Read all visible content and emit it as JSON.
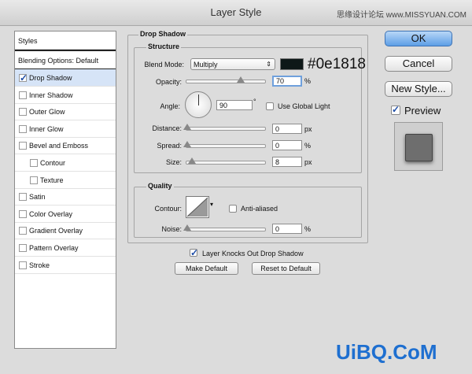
{
  "window": {
    "title": "Layer Style",
    "watermark_top": "思缘设计论坛 www.MISSYUAN.COM",
    "watermark_bottom": "UiBQ.CoM"
  },
  "sidebar": {
    "header": "Styles",
    "blending": "Blending Options: Default",
    "items": [
      {
        "label": "Drop Shadow",
        "checked": true,
        "selected": true,
        "indent": 0
      },
      {
        "label": "Inner Shadow",
        "checked": false,
        "indent": 0
      },
      {
        "label": "Outer Glow",
        "checked": false,
        "indent": 0
      },
      {
        "label": "Inner Glow",
        "checked": false,
        "indent": 0
      },
      {
        "label": "Bevel and Emboss",
        "checked": false,
        "indent": 0
      },
      {
        "label": "Contour",
        "checked": false,
        "indent": 1
      },
      {
        "label": "Texture",
        "checked": false,
        "indent": 1
      },
      {
        "label": "Satin",
        "checked": false,
        "indent": 0
      },
      {
        "label": "Color Overlay",
        "checked": false,
        "indent": 0
      },
      {
        "label": "Gradient Overlay",
        "checked": false,
        "indent": 0
      },
      {
        "label": "Pattern Overlay",
        "checked": false,
        "indent": 0
      },
      {
        "label": "Stroke",
        "checked": false,
        "indent": 0
      }
    ]
  },
  "drop_shadow": {
    "section_title": "Drop Shadow",
    "structure": {
      "title": "Structure",
      "blend_mode_label": "Blend Mode:",
      "blend_mode_value": "Multiply",
      "color_hex": "#0e1818",
      "opacity_label": "Opacity:",
      "opacity_value": "70",
      "opacity_fraction": 0.7,
      "angle_label": "Angle:",
      "angle_value": "90",
      "angle_unit": "°",
      "use_global_light_label": "Use Global Light",
      "distance_label": "Distance:",
      "distance_value": "0",
      "spread_label": "Spread:",
      "spread_value": "0",
      "size_label": "Size:",
      "size_value": "8",
      "unit_px": "px",
      "unit_pct": "%"
    },
    "quality": {
      "title": "Quality",
      "contour_label": "Contour:",
      "anti_aliased_label": "Anti-aliased",
      "noise_label": "Noise:",
      "noise_value": "0"
    },
    "knockout_label": "Layer Knocks Out Drop Shadow",
    "make_default_label": "Make Default",
    "reset_default_label": "Reset to Default"
  },
  "buttons": {
    "ok": "OK",
    "cancel": "Cancel",
    "new_style": "New Style...",
    "preview": "Preview"
  }
}
